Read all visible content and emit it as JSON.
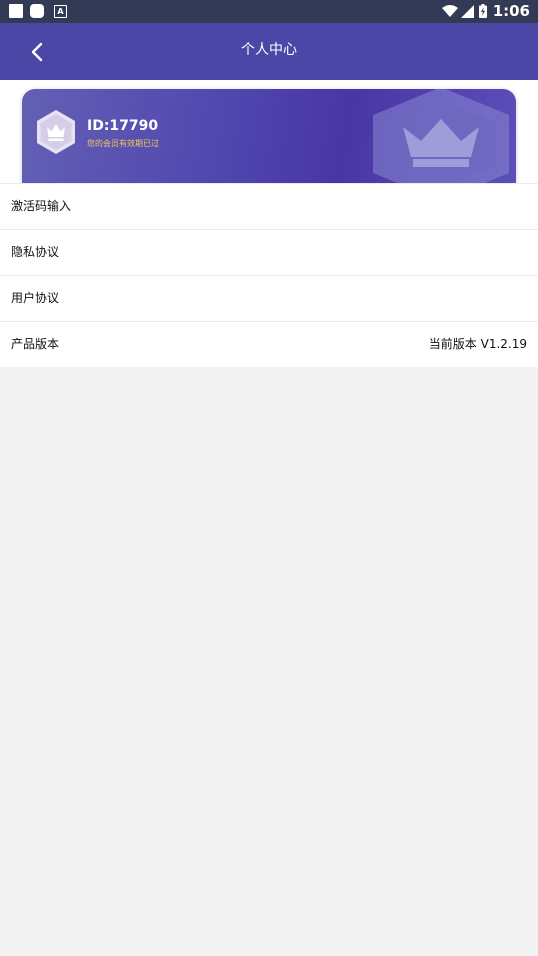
{
  "status_bar": {
    "time": "1:06",
    "notification_glyph": "A",
    "icons": [
      "white-square-icon",
      "rounded-square-icon",
      "a-box-icon",
      "wifi-icon",
      "signal-icon",
      "battery-charging-icon"
    ]
  },
  "app_bar": {
    "title": "个人中心",
    "back_icon": "chevron-left-icon",
    "background": "#4b47a6"
  },
  "member_card": {
    "id_text": "ID:17790",
    "status_text": "您的会员有效期已过",
    "icons": [
      "crown-badge-icon",
      "large-crown-watermark-icon"
    ],
    "status_color": "#f2cd52"
  },
  "menu": {
    "items": [
      {
        "label": "激活码输入"
      },
      {
        "label": "隐私协议"
      },
      {
        "label": "用户协议"
      },
      {
        "label": "产品版本",
        "value": "当前版本 V1.2.19"
      }
    ]
  }
}
